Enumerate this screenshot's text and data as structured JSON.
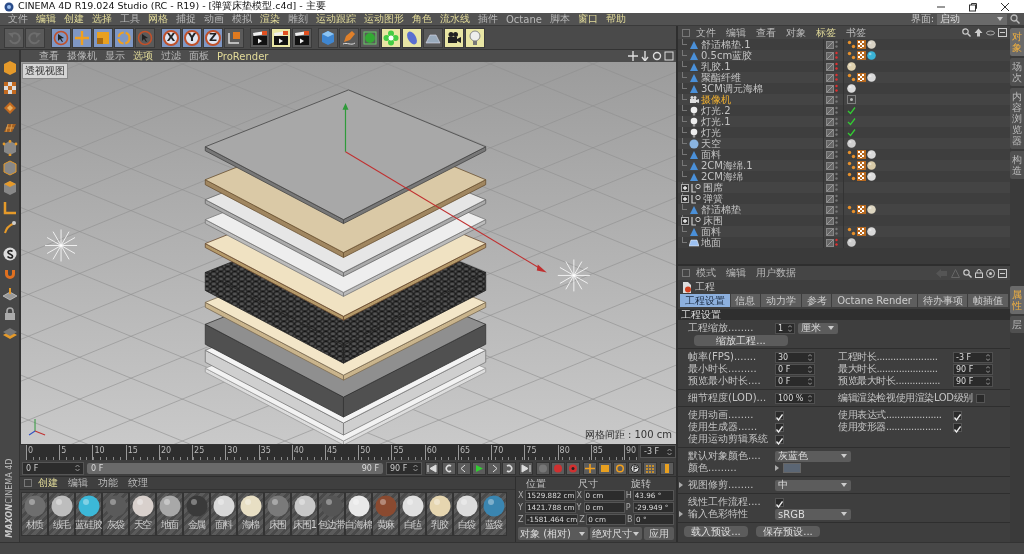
{
  "window": {
    "title": "CINEMA 4D R19.024 Studio (RC - R19) - [弹簧床垫模型.c4d] - 主要"
  },
  "menu": [
    {
      "label": "文件",
      "highlighted": false
    },
    {
      "label": "编辑",
      "highlighted": true
    },
    {
      "label": "创建",
      "highlighted": true
    },
    {
      "label": "选择",
      "highlighted": true
    },
    {
      "label": "工具",
      "highlighted": false
    },
    {
      "label": "网格",
      "highlighted": true
    },
    {
      "label": "捕捉",
      "highlighted": false
    },
    {
      "label": "动画",
      "highlighted": false
    },
    {
      "label": "模拟",
      "highlighted": false
    },
    {
      "label": "渲染",
      "highlighted": true
    },
    {
      "label": "雕刻",
      "highlighted": false
    },
    {
      "label": "运动跟踪",
      "highlighted": true
    },
    {
      "label": "运动图形",
      "highlighted": true
    },
    {
      "label": "角色",
      "highlighted": true
    },
    {
      "label": "流水线",
      "highlighted": true
    },
    {
      "label": "插件",
      "highlighted": false
    },
    {
      "label": "Octane",
      "highlighted": false
    },
    {
      "label": "脚本",
      "highlighted": false
    },
    {
      "label": "窗口",
      "highlighted": true
    },
    {
      "label": "帮助",
      "highlighted": true
    }
  ],
  "layout_selector": {
    "label": "界面:",
    "value": "启动"
  },
  "toolbar": [
    [
      {
        "kind": "undo",
        "active": false
      },
      {
        "kind": "redo",
        "active": false
      }
    ],
    [
      {
        "kind": "select",
        "active": true
      },
      {
        "kind": "move",
        "active": true
      },
      {
        "kind": "scale",
        "active": true
      },
      {
        "kind": "rotate",
        "active": true
      },
      {
        "kind": "pointer",
        "active": false
      }
    ],
    [
      {
        "kind": "axis",
        "label": "X",
        "active": true
      },
      {
        "kind": "axis",
        "label": "Y",
        "active": true
      },
      {
        "kind": "axis",
        "label": "Z",
        "active": true
      },
      {
        "kind": "coords",
        "active": false
      }
    ],
    [
      {
        "kind": "clapper",
        "active": false
      },
      {
        "kind": "clapper",
        "active": true
      },
      {
        "kind": "clapper",
        "active": false
      }
    ],
    [
      {
        "kind": "cube",
        "active": false
      },
      {
        "kind": "pen",
        "active": false
      },
      {
        "kind": "subdiv",
        "active": false
      },
      {
        "kind": "flower",
        "active": true
      },
      {
        "kind": "deformer",
        "active": true
      },
      {
        "kind": "floor",
        "active": false
      },
      {
        "kind": "camera",
        "active": true
      },
      {
        "kind": "light",
        "active": true
      }
    ]
  ],
  "viewport": {
    "menu": [
      {
        "label": "查看",
        "highlighted": false
      },
      {
        "label": "摄像机",
        "highlighted": false
      },
      {
        "label": "显示",
        "highlighted": false
      },
      {
        "label": "选项",
        "highlighted": true
      },
      {
        "label": "过滤",
        "highlighted": false
      },
      {
        "label": "面板",
        "highlighted": false
      },
      {
        "label": "ProRender",
        "highlighted": true
      }
    ],
    "label": "透视视图",
    "grid_info": "网格间距 : 100 cm"
  },
  "timeline": {
    "ticks": [
      "0",
      "5",
      "10",
      "15",
      "20",
      "25",
      "30",
      "35",
      "40",
      "45",
      "50",
      "55",
      "60",
      "65",
      "70",
      "75",
      "80",
      "85",
      "90"
    ],
    "current": "-3 F"
  },
  "playback": {
    "start": "0 F",
    "range_start": "0 F",
    "range_end": "90 F",
    "end": "90 F",
    "level": 1
  },
  "materials": {
    "menu": [
      {
        "label": "创建",
        "highlighted": true
      },
      {
        "label": "编辑",
        "highlighted": false
      },
      {
        "label": "功能",
        "highlighted": false
      },
      {
        "label": "纹理",
        "highlighted": false
      }
    ],
    "items": [
      {
        "name": "材质",
        "color": "#6e6e6e"
      },
      {
        "name": "绒毛",
        "color": "#bdbdbd"
      },
      {
        "name": "蓝硅胶",
        "color": "#3cb8d8"
      },
      {
        "name": "灰袋",
        "color": "#5a5a5a"
      },
      {
        "name": "天空",
        "color": "#d8d0cc"
      },
      {
        "name": "地面",
        "color": "#a8a8a8"
      },
      {
        "name": "金属",
        "color": "#3a3a3a"
      },
      {
        "name": "面料",
        "color": "#d8d8d8"
      },
      {
        "name": "海棉",
        "color": "#e8dfc4"
      },
      {
        "name": "床围",
        "color": "#7a7a7a"
      },
      {
        "name": "床围1",
        "color": "#c8c8c8"
      },
      {
        "name": "包边带",
        "color": "#555555"
      },
      {
        "name": "白海棉",
        "color": "#e8e8e8"
      },
      {
        "name": "黄麻",
        "color": "#8a4a30"
      },
      {
        "name": "白毡",
        "color": "#e0e0e0"
      },
      {
        "name": "乳胶",
        "color": "#e6d6b0"
      },
      {
        "name": "白袋",
        "color": "#dcdcdc"
      },
      {
        "name": "蓝袋",
        "color": "#3a85b0"
      }
    ]
  },
  "coordinates": {
    "headers": [
      "位置",
      "尺寸",
      "旋转"
    ],
    "rows": [
      {
        "axis": "X",
        "position": "1529.882 cm",
        "size_axis": "X",
        "size": "0 cm",
        "rotation_axis": "H",
        "rotation": "43.96 °"
      },
      {
        "axis": "Y",
        "position": "1421.788 cm",
        "size_axis": "Y",
        "size": "0 cm",
        "rotation_axis": "P",
        "rotation": "-29.949 °"
      },
      {
        "axis": "Z",
        "position": "-1581.464 cm",
        "size_axis": "Z",
        "size": "0 cm",
        "rotation_axis": "B",
        "rotation": "0 °"
      }
    ],
    "mode": "对象 (相对)",
    "size_mode": "绝对尺寸",
    "apply": "应用"
  },
  "objects": {
    "menu": [
      {
        "label": "文件",
        "highlighted": false
      },
      {
        "label": "编辑",
        "highlighted": false
      },
      {
        "label": "查看",
        "highlighted": false
      },
      {
        "label": "对象",
        "highlighted": false
      },
      {
        "label": "标签",
        "highlighted": true
      },
      {
        "label": "书签",
        "highlighted": false
      }
    ],
    "rows": [
      {
        "name": "舒适棉垫.1",
        "kind": "polygon",
        "selected": false,
        "hidden": false,
        "tags": [
          {
            "kind": "phong"
          },
          {
            "kind": "texture"
          },
          {
            "kind": "material",
            "color": "#d8d2c4"
          }
        ]
      },
      {
        "name": "0.5cm蓝胶",
        "kind": "polygon",
        "selected": false,
        "hidden": true,
        "tags": [
          {
            "kind": "phong"
          },
          {
            "kind": "texture"
          },
          {
            "kind": "material",
            "color": "#3ab3d6"
          }
        ]
      },
      {
        "name": "乳胶.1",
        "kind": "polygon",
        "selected": false,
        "hidden": true,
        "tags": [
          {
            "kind": "material",
            "color": "#e0d2b0"
          }
        ]
      },
      {
        "name": "聚酯纤维",
        "kind": "polygon",
        "selected": false,
        "hidden": true,
        "tags": [
          {
            "kind": "phong"
          },
          {
            "kind": "texture"
          },
          {
            "kind": "material",
            "color": "#d9d9d9"
          }
        ]
      },
      {
        "name": "3CM调元海棉",
        "kind": "polygon",
        "selected": false,
        "hidden": true,
        "tags": [
          {
            "kind": "material",
            "color": "#dddddd"
          }
        ]
      },
      {
        "name": "摄像机",
        "kind": "camera",
        "selected": true,
        "hidden": false,
        "tags": [
          {
            "kind": "target"
          }
        ]
      },
      {
        "name": "灯光.2",
        "kind": "light",
        "selected": false,
        "hidden": false,
        "tags": [
          {
            "kind": "check"
          }
        ]
      },
      {
        "name": "灯光.1",
        "kind": "light",
        "selected": false,
        "hidden": false,
        "tags": [
          {
            "kind": "check"
          }
        ]
      },
      {
        "name": "灯光",
        "kind": "light",
        "selected": false,
        "hidden": false,
        "tags": [
          {
            "kind": "check"
          }
        ]
      },
      {
        "name": "天空",
        "kind": "sky",
        "selected": false,
        "hidden": false,
        "tags": [
          {
            "kind": "material",
            "color": "#cfcfcf"
          }
        ]
      },
      {
        "name": "面料",
        "kind": "polygon",
        "selected": false,
        "hidden": false,
        "tags": [
          {
            "kind": "phong"
          },
          {
            "kind": "texture"
          },
          {
            "kind": "material",
            "color": "#d9d9d9"
          }
        ]
      },
      {
        "name": "2CM海绵.1",
        "kind": "polygon",
        "selected": false,
        "hidden": false,
        "tags": [
          {
            "kind": "phong"
          },
          {
            "kind": "texture"
          },
          {
            "kind": "material",
            "color": "#d9cba8"
          }
        ]
      },
      {
        "name": "2CM海绵",
        "kind": "polygon",
        "selected": false,
        "hidden": false,
        "tags": [
          {
            "kind": "phong"
          },
          {
            "kind": "texture"
          },
          {
            "kind": "material",
            "color": "#dddddd"
          }
        ]
      },
      {
        "name": "围席",
        "kind": "group",
        "expanded": false,
        "selected": false,
        "hidden": false,
        "tags": []
      },
      {
        "name": "弹簧",
        "kind": "group",
        "expanded": false,
        "selected": false,
        "hidden": false,
        "tags": []
      },
      {
        "name": "舒适棉垫",
        "kind": "polygon",
        "selected": false,
        "hidden": false,
        "tags": [
          {
            "kind": "phong"
          },
          {
            "kind": "texture"
          },
          {
            "kind": "material",
            "color": "#ddd5c0"
          }
        ]
      },
      {
        "name": "床围",
        "kind": "group",
        "expanded": false,
        "selected": false,
        "hidden": false,
        "tags": []
      },
      {
        "name": "面料",
        "kind": "polygon",
        "selected": false,
        "hidden": false,
        "tags": [
          {
            "kind": "phong"
          },
          {
            "kind": "texture"
          },
          {
            "kind": "material",
            "color": "#d9d9d9"
          }
        ]
      },
      {
        "name": "地面",
        "kind": "floor",
        "selected": false,
        "hidden": true,
        "tags": [
          {
            "kind": "material",
            "color": "#cccccc"
          }
        ]
      }
    ]
  },
  "attributes": {
    "menu": [
      {
        "label": "模式",
        "highlighted": false
      },
      {
        "label": "编辑",
        "highlighted": false
      },
      {
        "label": "用户数据",
        "highlighted": false
      }
    ],
    "title": "工程",
    "tabs": [
      {
        "label": "工程设置",
        "selected": true
      },
      {
        "label": "信息",
        "selected": false
      },
      {
        "label": "动力学",
        "selected": false
      },
      {
        "label": "参考",
        "selected": false
      },
      {
        "label": "Octane Render",
        "selected": false
      },
      {
        "label": "待办事项",
        "selected": false
      },
      {
        "label": "帧插值",
        "selected": false
      }
    ],
    "section_title": "工程设置",
    "groups": [
      [
        [
          {
            "kind": "field",
            "label": "工程缩放........",
            "value": "1"
          },
          {
            "kind": "select",
            "value": "厘米"
          }
        ],
        [
          {
            "kind": "button",
            "label": "缩放工程..."
          }
        ]
      ],
      [
        [
          {
            "kind": "field",
            "label": "帧率(FPS).......",
            "value": "30"
          },
          {
            "kind": "field",
            "label": "工程时长......................",
            "value": "-3 F"
          }
        ],
        [
          {
            "kind": "field",
            "label": "最小时长.........",
            "value": "0 F"
          },
          {
            "kind": "field",
            "label": "最大时长......................",
            "value": "90 F"
          }
        ],
        [
          {
            "kind": "field",
            "label": "预览最小时长....",
            "value": "0 F"
          },
          {
            "kind": "field",
            "label": "预览最大时长................",
            "value": "90 F"
          }
        ]
      ],
      [
        [
          {
            "kind": "field",
            "label": "细节程度(LOD)...",
            "value": "100 %"
          },
          {
            "kind": "check",
            "label": "编辑渲染检视使用渲染LOD级别",
            "checked": false
          }
        ]
      ],
      [
        [
          {
            "kind": "check",
            "label": "使用动画........",
            "checked": true
          },
          {
            "kind": "check",
            "label": "使用表达式....................",
            "checked": true
          }
        ],
        [
          {
            "kind": "check",
            "label": "使用生成器......",
            "checked": true
          },
          {
            "kind": "check",
            "label": "使用变形器....................",
            "checked": true
          }
        ],
        [
          {
            "kind": "check",
            "label": "使用运动剪辑系统",
            "checked": true
          }
        ]
      ],
      [
        [
          {
            "kind": "select",
            "label": "默认对象颜色....",
            "value": "灰蓝色"
          }
        ],
        [
          {
            "kind": "color",
            "label": "颜色.........",
            "expanded": false,
            "color": "#5b6674"
          }
        ]
      ],
      [
        [
          {
            "kind": "select",
            "label": "视图修剪........",
            "value": "中",
            "expanded": false
          }
        ]
      ],
      [
        [
          {
            "kind": "check",
            "label": "线性工作流程....",
            "checked": true
          }
        ],
        [
          {
            "kind": "select",
            "label": "输入色彩特性",
            "value": "sRGB",
            "expanded": false
          }
        ]
      ]
    ],
    "buttons": [
      "载入预设...",
      "保存预设..."
    ]
  },
  "side_tabs": [
    {
      "label": "对象",
      "selected": true
    },
    {
      "label": "场次",
      "selected": false
    },
    {
      "label": "内容浏览器",
      "selected": false
    },
    {
      "label": "构造",
      "selected": false
    }
  ],
  "attribute_side_tabs": [
    {
      "label": "属性",
      "selected": true
    },
    {
      "label": "层",
      "selected": false
    }
  ],
  "logo": [
    "MAXON",
    "CINEMA 4D"
  ]
}
